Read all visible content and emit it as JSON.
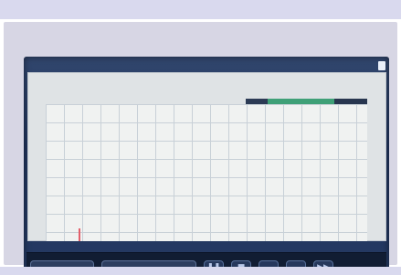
{
  "top_bar": {
    "left_text": "",
    "right_text": ""
  },
  "plot": {
    "legend_left": "",
    "legend_right": ""
  },
  "controls": {
    "right_group_text": ""
  },
  "transport": {
    "pause_symbol": "❚❚",
    "stop_symbol": "■",
    "prev_symbol": "",
    "next_symbol": "",
    "skip_symbol": "▶▶"
  }
}
